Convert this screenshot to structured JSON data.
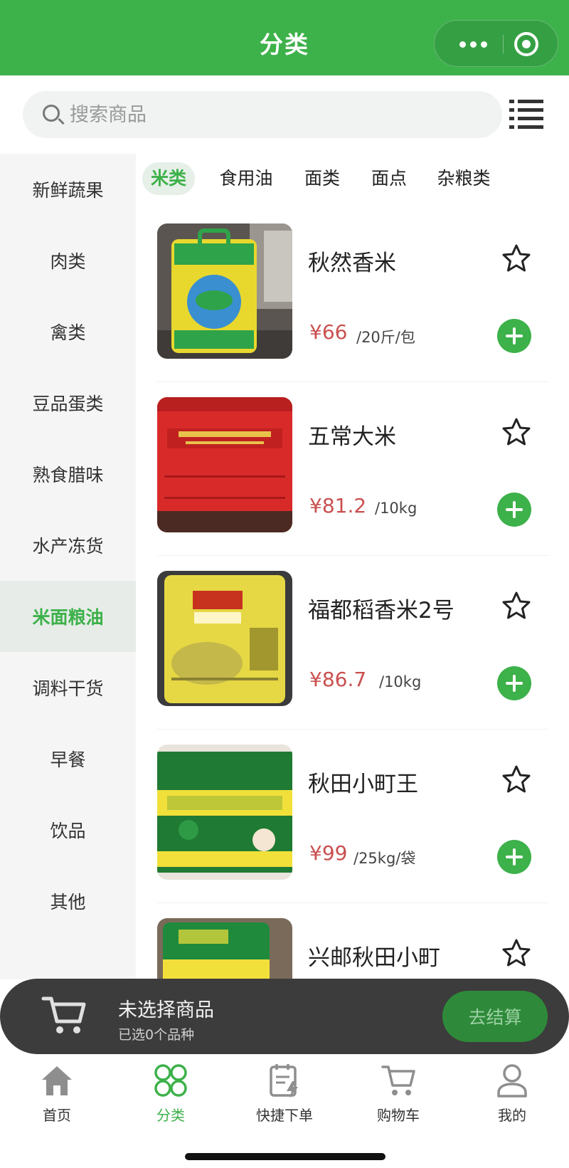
{
  "header": {
    "title": "分类"
  },
  "search": {
    "placeholder": "搜索商品"
  },
  "sidebar": {
    "items": [
      {
        "label": "新鲜蔬果"
      },
      {
        "label": "肉类"
      },
      {
        "label": "禽类"
      },
      {
        "label": "豆品蛋类"
      },
      {
        "label": "熟食腊味"
      },
      {
        "label": "水产冻货"
      },
      {
        "label": "米面粮油",
        "active": true
      },
      {
        "label": "调料干货"
      },
      {
        "label": "早餐"
      },
      {
        "label": "饮品"
      },
      {
        "label": "其他"
      }
    ]
  },
  "tabs": [
    {
      "label": "米类",
      "active": true
    },
    {
      "label": "食用油"
    },
    {
      "label": "面类"
    },
    {
      "label": "面点"
    },
    {
      "label": "杂粮类"
    }
  ],
  "products": [
    {
      "name": "秋然香米",
      "price": "¥66",
      "unit": "/20斤/包"
    },
    {
      "name": "五常大米",
      "price": "¥81.2",
      "unit": "/10kg"
    },
    {
      "name": "福都稻香米2号",
      "price": "¥86.7",
      "unit": "/10kg"
    },
    {
      "name": "秋田小町王",
      "price": "¥99",
      "unit": "/25kg/袋"
    },
    {
      "name": "兴邮秋田小町",
      "price": "",
      "unit": ""
    }
  ],
  "cart": {
    "title": "未选择商品",
    "subtitle": "已选0个品种",
    "checkout_label": "去结算"
  },
  "tabbar": {
    "items": [
      {
        "label": "首页",
        "icon": "home-icon"
      },
      {
        "label": "分类",
        "icon": "category-icon",
        "active": true
      },
      {
        "label": "快捷下单",
        "icon": "quick-order-icon"
      },
      {
        "label": "购物车",
        "icon": "cart-icon"
      },
      {
        "label": "我的",
        "icon": "profile-icon"
      }
    ]
  },
  "colors": {
    "brand_green": "#3db14a",
    "price_red": "#c9504f",
    "cart_bar": "#3c3c3c"
  }
}
